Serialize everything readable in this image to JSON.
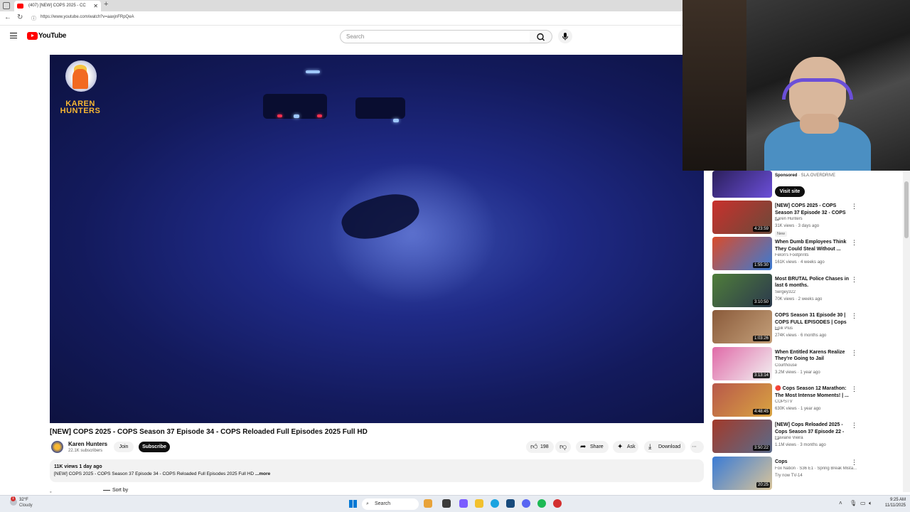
{
  "browser": {
    "tab_title": "(407) [NEW] COPS 2025 - CC",
    "url": "https://www.youtube.com/watch?v=aaxjnFRpQeA"
  },
  "header": {
    "logo_text": "YouTube",
    "search_placeholder": "Search"
  },
  "player": {
    "watermark_text": "KAREN HUNTERS"
  },
  "video": {
    "title": "[NEW] COPS 2025 - COPS Season 37 Episode 34 - COPS Reloaded Full Episodes 2025 Full HD",
    "channel": "Karen Hunters",
    "subscribers": "22.1K subscribers",
    "join_label": "Join",
    "subscribe_label": "Subscribe",
    "likes": "198",
    "share_label": "Share",
    "ask_label": "Ask",
    "download_label": "Download",
    "views_date": "11K views  1 day ago",
    "description": "[NEW] COPS 2025 - COPS Season 37 Episode 34 - COPS Reloaded Full Episodes 2025 Full HD",
    "more_label": "...more",
    "sort_label": "Sort by"
  },
  "sidebar": {
    "ad": {
      "sponsored_label": "Sponsored",
      "advertiser": "· SLA.OVERDRIVE",
      "visit_label": "Visit site"
    },
    "items": [
      {
        "title": "[NEW] COPS 2025 - COPS Season 37 Episode 32 - COPS ...",
        "channel": "Karen Hunters",
        "meta": "31K views · 3 days ago",
        "badge": "New",
        "duration": "4:23:59",
        "colors": [
          "#c9302c",
          "#6b4a3a"
        ]
      },
      {
        "title": "When Dumb Employees Think They Could Steal Without ...",
        "channel": "Felon's Footprints",
        "meta": "161K views · 4 weeks ago",
        "duration": "1:55:30",
        "colors": [
          "#d94b2b",
          "#3a7bd5"
        ]
      },
      {
        "title": "Most BRUTAL Police Chases in last 6 months.",
        "channel": "Sergey322",
        "meta": "70K views · 2 weeks ago",
        "duration": "3:10:50",
        "colors": [
          "#4f7d3a",
          "#2c3a4d"
        ]
      },
      {
        "title": "COPS Season 31 Episode 30 | COPS FULL EPISODES | Cops ...",
        "channel": "Epik Plus",
        "meta": "274K views · 6 months ago",
        "duration": "1:03:26",
        "colors": [
          "#8a5a3a",
          "#c4a07a"
        ]
      },
      {
        "title": "When Entitled Karens Realize They're Going to Jail",
        "channel": "Courthouse",
        "meta": "3.2M views · 1 year ago",
        "duration": "3:13:14",
        "colors": [
          "#e06aa8",
          "#f2f2f2"
        ]
      },
      {
        "title": "🔴 Cops Season 12 Marathon: The Most Intense Moments! | ...",
        "channel": "COPSTV",
        "meta": "630K views · 1 year ago",
        "duration": "4:48:45",
        "colors": [
          "#b8584a",
          "#d9a441"
        ]
      },
      {
        "title": "[NEW] Cops Reloaded 2025 - Cops Season 37 Episode 22 - ...",
        "channel": "Flaviane Vieira",
        "meta": "1.1M views · 3 months ago",
        "duration": "3:50:22",
        "colors": [
          "#a23a2a",
          "#5a6b8a"
        ]
      },
      {
        "title": "Cops",
        "channel": "Fox Nation · S36 E1 · Spring Break Mista...",
        "meta": "Try now  TV-14",
        "duration": "20:25",
        "colors": [
          "#3a7bd5",
          "#d9c49a"
        ]
      }
    ]
  },
  "taskbar": {
    "temp": "32°F",
    "condition": "Cloudy",
    "search_label": "Search",
    "time": "9:25 AM",
    "date": "11/11/2025",
    "notification_count": "1"
  }
}
